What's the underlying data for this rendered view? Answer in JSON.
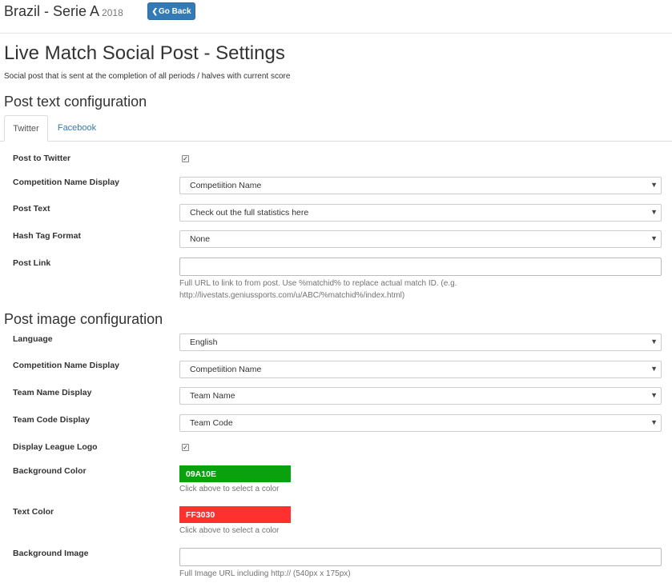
{
  "header": {
    "competition": "Brazil - Serie A",
    "year": "2018",
    "back_button": "Go Back",
    "back_icon": "chevron-left-icon"
  },
  "page": {
    "title": "Live Match Social Post - Settings",
    "subtitle": "Social post that is sent at the completion of all periods / halves with current score"
  },
  "text_config": {
    "title": "Post text configuration",
    "tabs": [
      {
        "label": "Twitter",
        "active": true
      },
      {
        "label": "Facebook",
        "active": false
      }
    ],
    "post_to_twitter": {
      "label": "Post to Twitter",
      "checked": true
    },
    "competition_name_display": {
      "label": "Competition Name Display",
      "value": "Competiition Name"
    },
    "post_text": {
      "label": "Post Text",
      "value": "Check out the full statistics here"
    },
    "hash_tag_format": {
      "label": "Hash Tag Format",
      "value": "None"
    },
    "post_link": {
      "label": "Post Link",
      "value": "",
      "help_line1": "Full URL to link to from post. Use %matchid% to replace actual match ID. (e.g.",
      "help_line2": "http://livestats.geniussports.com/u/ABC/%matchid%/index.html)"
    }
  },
  "image_config": {
    "title": "Post image configuration",
    "language": {
      "label": "Language",
      "value": "English"
    },
    "competition_name_display": {
      "label": "Competition Name Display",
      "value": "Competiition Name"
    },
    "team_name_display": {
      "label": "Team Name Display",
      "value": "Team Name"
    },
    "team_code_display": {
      "label": "Team Code Display",
      "value": "Team Code"
    },
    "display_league_logo": {
      "label": "Display League Logo",
      "checked": true
    },
    "background_color": {
      "label": "Background Color",
      "value": "09A10E",
      "color": "#09A10E",
      "help": "Click above to select a color"
    },
    "text_color": {
      "label": "Text Color",
      "value": "FF3030",
      "color": "#FF3030",
      "help": "Click above to select a color"
    },
    "background_image": {
      "label": "Background Image",
      "value": "",
      "help": "Full Image URL including http:// (540px x 175px)"
    }
  },
  "colors": {
    "accent": "#337ab7"
  }
}
